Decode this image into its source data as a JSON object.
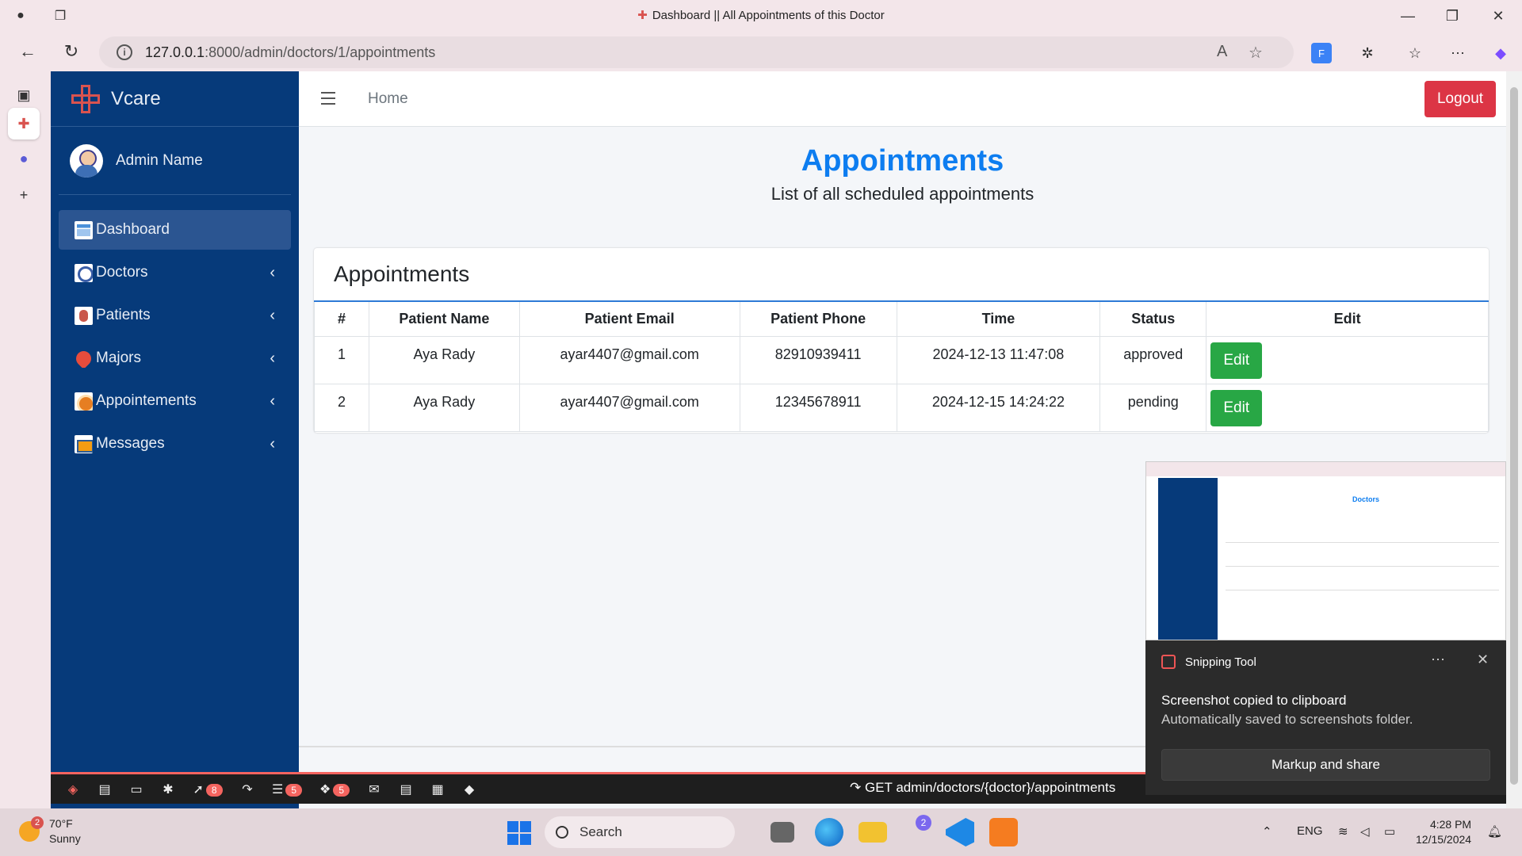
{
  "browser": {
    "tab_title": "Dashboard || All Appointments of this Doctor",
    "url_host": "127.0.0.1",
    "url_path": ":8000/admin/doctors/1/appointments"
  },
  "sidebar": {
    "brand": "Vcare",
    "user_name": "Admin Name",
    "items": [
      {
        "label": "Dashboard",
        "icon": "dashboard-icon",
        "active": true
      },
      {
        "label": "Doctors",
        "icon": "doctor-icon"
      },
      {
        "label": "Patients",
        "icon": "patient-icon"
      },
      {
        "label": "Majors",
        "icon": "heart-pin-icon"
      },
      {
        "label": "Appointements",
        "icon": "appointment-icon"
      },
      {
        "label": "Messages",
        "icon": "messages-icon"
      }
    ]
  },
  "topnav": {
    "home": "Home",
    "logout": "Logout"
  },
  "page": {
    "title": "Appointments",
    "subtitle": "List of all scheduled appointments"
  },
  "card": {
    "title": "Appointments",
    "columns": [
      "#",
      "Patient Name",
      "Patient Email",
      "Patient Phone",
      "Time",
      "Status",
      "Edit"
    ],
    "rows": [
      {
        "num": "1",
        "name": "Aya Rady",
        "email": "ayar4407@gmail.com",
        "phone": "82910939411",
        "time": "2024-12-13 11:47:08",
        "status": "approved",
        "edit": "Edit"
      },
      {
        "num": "2",
        "name": "Aya Rady",
        "email": "ayar4407@gmail.com",
        "phone": "12345678911",
        "time": "2024-12-15 14:24:22",
        "status": "pending",
        "edit": "Edit"
      }
    ]
  },
  "debugbar": {
    "badges": [
      "8",
      "5",
      "5"
    ],
    "route": "GET admin/doctors/{doctor}/appointments"
  },
  "toast": {
    "app": "Snipping Tool",
    "title": "Screenshot copied to clipboard",
    "body": "Automatically saved to screenshots folder.",
    "button": "Markup and share",
    "preview_title": "Doctors"
  },
  "taskbar": {
    "temp": "70°F",
    "condition": "Sunny",
    "weather_badge": "2",
    "search": "Search",
    "teams_badge": "2",
    "lang": "ENG",
    "time": "4:28 PM",
    "date": "12/15/2024"
  },
  "colors": {
    "sidebar": "#063a7a",
    "accent": "#0d7df0",
    "logout": "#dc3545",
    "edit": "#28a745"
  }
}
